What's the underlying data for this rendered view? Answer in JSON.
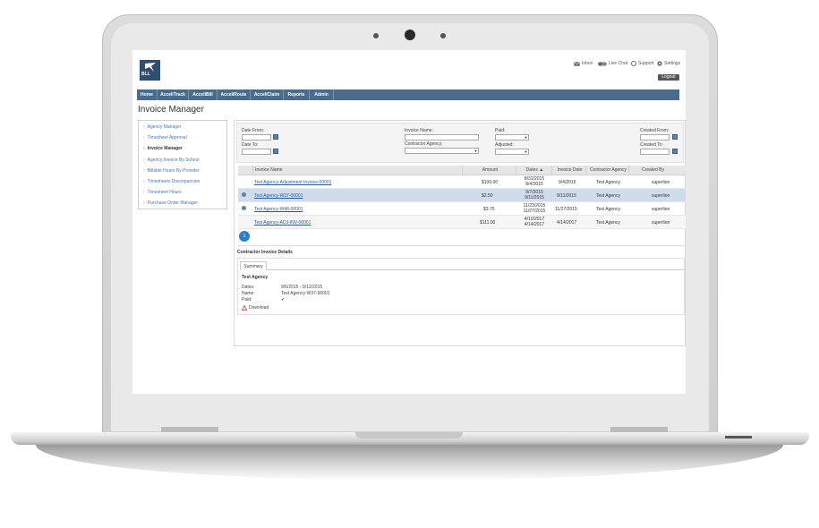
{
  "header": {
    "logo_text": "BLL",
    "utilities": [
      {
        "label": "Inbox",
        "icon": "envelope-icon"
      },
      {
        "label": "Live Chat",
        "icon": "chat-icon"
      },
      {
        "label": "Support",
        "icon": "support-icon"
      },
      {
        "label": "Settings",
        "icon": "gear-icon"
      }
    ],
    "logout_label": "Logout"
  },
  "nav": [
    "Home",
    "AcceliTrack",
    "AcceliBill",
    "AcceliRoute",
    "AcceliClaim",
    "Reports",
    "Admin"
  ],
  "page_title": "Invoice Manager",
  "sidebar": {
    "items": [
      "Agency Manager",
      "Timesheet Approval",
      "Invoice Manager",
      "Agency Invoice By School",
      "Billable Hours By Provider",
      "Timesheets Discrepancies",
      "Timesheet Hours",
      "Purchase Order Manager"
    ],
    "active": "Invoice Manager"
  },
  "filters": {
    "date_from": "Date From:",
    "date_to": "Date To:",
    "invoice_name": "Invoice Name:",
    "contractor_agency": "Contractor Agency:",
    "paid": "Paid:",
    "adjusted": "Adjusted:",
    "created_from": "Created From:",
    "created_to": "Created To:"
  },
  "grid": {
    "columns": [
      "Invoice Name",
      "Amount",
      "Dates ▲",
      "Invoice Date",
      "Contractor Agency",
      "Created By"
    ],
    "rows": [
      {
        "name": "Test Agency-Adjustment Invoice-00001",
        "amount": "$100.00",
        "date1": "8/31/2015",
        "date2": "8/4/2015",
        "invoice_date": "9/4/2015",
        "agency": "Test Agency",
        "created_by": "superlion",
        "info": false
      },
      {
        "name": "Test Agency-W37-00001",
        "amount": "$2.50",
        "date1": "9/7/2015",
        "date2": "9/11/2015",
        "invoice_date": "9/11/2015",
        "agency": "Test Agency",
        "created_by": "superlion",
        "info": true
      },
      {
        "name": "Test Agency-W48-00001",
        "amount": "$3.75",
        "date1": "11/23/2015",
        "date2": "11/27/2015",
        "invoice_date": "11/27/2015",
        "agency": "Test Agency",
        "created_by": "superlion",
        "info": true
      },
      {
        "name": "Test Agency-ADJ-INV-00001",
        "amount": "$111.00",
        "date1": "4/10/2017",
        "date2": "4/14/2017",
        "invoice_date": "4/14/2017",
        "agency": "Test Agency",
        "created_by": "superlion",
        "info": false
      }
    ],
    "page": "1"
  },
  "details": {
    "title": "Contractor Invoice Details",
    "tab": "Summary",
    "agency": "Test Agency",
    "dates_label": "Dates:",
    "dates_value": "9/6/2015 - 9/12/2015",
    "name_label": "Name:",
    "name_value": "Test Agency-W37-00001",
    "paid_label": "Paid:",
    "paid_check": "✔",
    "download_label": "Download"
  },
  "colors": {
    "nav": "#4a6c8c",
    "link": "#2b5a9b",
    "selected_row": "#cfdceb",
    "pager": "#2a80c8"
  }
}
